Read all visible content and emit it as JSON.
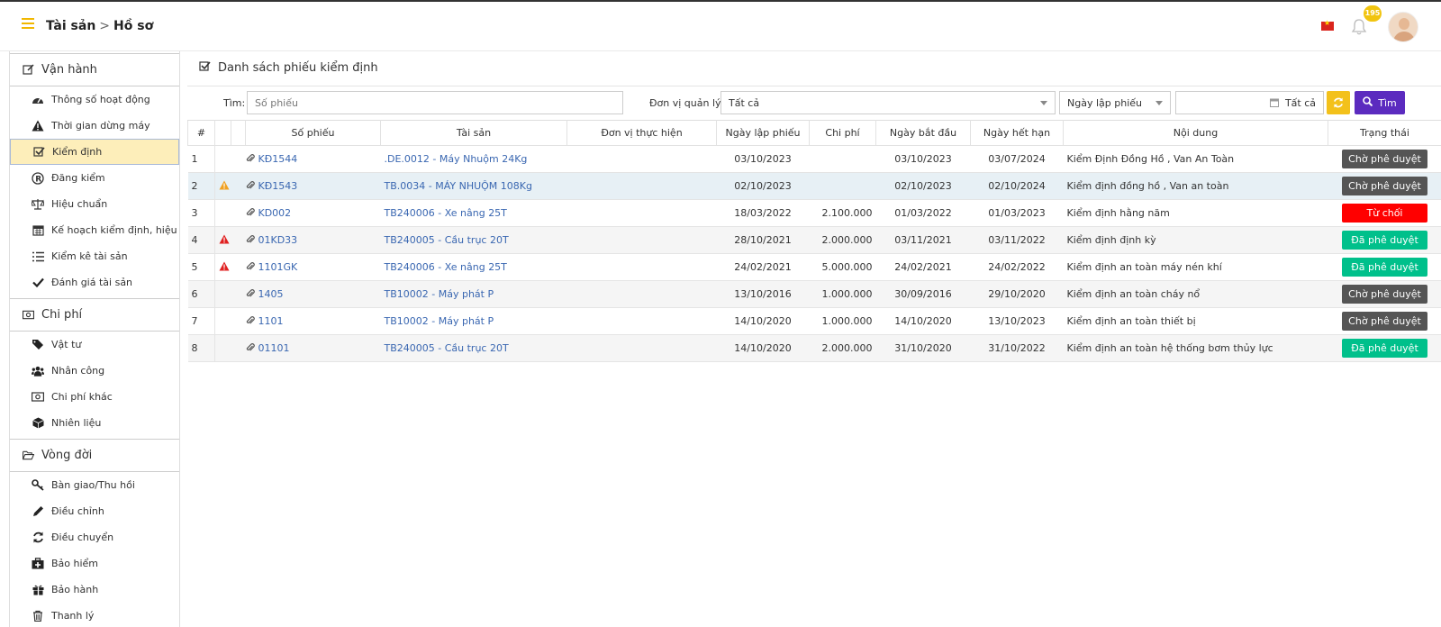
{
  "header": {
    "breadcrumb": [
      "Tài sản",
      "Hồ sơ"
    ],
    "notification_count": "195"
  },
  "sidebar": {
    "sections": [
      {
        "title": "Vận hành",
        "items": [
          "Thông số hoạt động",
          "Thời gian dừng máy",
          "Kiểm định",
          "Đăng kiểm",
          "Hiệu chuẩn",
          "Kế hoạch kiểm định, hiệu chuẩn",
          "Kiểm kê tài sản",
          "Đánh giá tài sản"
        ]
      },
      {
        "title": "Chi phí",
        "items": [
          "Vật tư",
          "Nhân công",
          "Chi phí khác",
          "Nhiên liệu"
        ]
      },
      {
        "title": "Vòng đời",
        "items": [
          "Bàn giao/Thu hồi",
          "Điều chỉnh",
          "Điều chuyển",
          "Bảo hiểm",
          "Bảo hành",
          "Thanh lý"
        ]
      }
    ],
    "active_item": "Kiểm định"
  },
  "main": {
    "title": "Danh sách phiếu kiểm định",
    "filters": {
      "search_label": "Tìm:",
      "search_placeholder": "Số phiếu",
      "unit_label": "Đơn vị quản lý:",
      "unit_value": "Tất cả",
      "date_type_value": "Ngày lập phiếu",
      "date_range_value": "Tất cả",
      "search_button": "Tìm"
    },
    "table": {
      "columns": [
        "#",
        "",
        "",
        "Số phiếu",
        "Tài sản",
        "Đơn vị thực hiện",
        "Ngày lập phiếu",
        "Chi phí",
        "Ngày bắt đầu",
        "Ngày hết hạn",
        "Nội dung",
        "Trạng thái"
      ],
      "rows": [
        {
          "no": "1",
          "warn": "",
          "code": "KĐ1544",
          "asset": ".DE.0012 - Máy Nhuộm 24Kg",
          "unit": "",
          "created": "03/10/2023",
          "cost": "",
          "start": "03/10/2023",
          "expire": "03/07/2024",
          "content": "Kiểm Định Đồng Hồ , Van An Toàn",
          "status": "Chờ phê duyệt"
        },
        {
          "no": "2",
          "warn": "orange",
          "code": "KĐ1543",
          "asset": "TB.0034 - MÁY NHUỘM 108Kg",
          "unit": "",
          "created": "02/10/2023",
          "cost": "",
          "start": "02/10/2023",
          "expire": "02/10/2024",
          "content": "Kiểm định đồng hồ , Van an toàn",
          "status": "Chờ phê duyệt"
        },
        {
          "no": "3",
          "warn": "",
          "code": "KD002",
          "asset": "TB240006 - Xe nâng 25T",
          "unit": "",
          "created": "18/03/2022",
          "cost": "2.100.000",
          "start": "01/03/2022",
          "expire": "01/03/2023",
          "content": "Kiểm định hằng năm",
          "status": "Từ chối"
        },
        {
          "no": "4",
          "warn": "red",
          "code": "01KD33",
          "asset": "TB240005 - Cầu trục 20T",
          "unit": "",
          "created": "28/10/2021",
          "cost": "2.000.000",
          "start": "03/11/2021",
          "expire": "03/11/2022",
          "content": "Kiểm định định kỳ",
          "status": "Đã phê duyệt"
        },
        {
          "no": "5",
          "warn": "red",
          "code": "1101GK",
          "asset": "TB240006 - Xe nâng 25T",
          "unit": "",
          "created": "24/02/2021",
          "cost": "5.000.000",
          "start": "24/02/2021",
          "expire": "24/02/2022",
          "content": "Kiểm định an toàn máy nén khí",
          "status": "Đã phê duyệt"
        },
        {
          "no": "6",
          "warn": "",
          "code": "1405",
          "asset": "TB10002 - Máy phát P",
          "unit": "",
          "created": "13/10/2016",
          "cost": "1.000.000",
          "start": "30/09/2016",
          "expire": "29/10/2020",
          "content": "Kiểm định an toàn cháy nổ",
          "status": "Chờ phê duyệt"
        },
        {
          "no": "7",
          "warn": "",
          "code": "1101",
          "asset": "TB10002 - Máy phát P",
          "unit": "",
          "created": "14/10/2020",
          "cost": "1.000.000",
          "start": "14/10/2020",
          "expire": "13/10/2023",
          "content": "Kiểm định an toàn thiết bị",
          "status": "Chờ phê duyệt"
        },
        {
          "no": "8",
          "warn": "",
          "code": "01101",
          "asset": "TB240005 - Cầu trục 20T",
          "unit": "",
          "created": "14/10/2020",
          "cost": "2.000.000",
          "start": "31/10/2020",
          "expire": "31/10/2022",
          "content": "Kiểm định an toàn hệ thống bơm thủy lực",
          "status": "Đã phê duyệt"
        }
      ]
    }
  },
  "colors": {
    "accent_yellow": "#f3c11b",
    "search_purple": "#5b2bbf",
    "status_pending": "#555555",
    "status_rejected": "#ff0000",
    "status_approved": "#00c08b",
    "link": "#3a67b1"
  },
  "icons": {
    "sidebar_sections": [
      "edit-icon",
      "money-icon",
      "folder-open-icon"
    ],
    "sidebar_items": [
      [
        "dashboard-icon",
        "warning-icon",
        "check-square-icon",
        "registered-icon",
        "balance-scale-icon",
        "calendar-icon",
        "list-icon",
        "check-icon"
      ],
      [
        "tags-icon",
        "users-icon",
        "money-icon",
        "cube-icon"
      ],
      [
        "key-icon",
        "pencil-icon",
        "refresh-icon",
        "medkit-icon",
        "gift-icon",
        "trash-icon"
      ]
    ]
  }
}
